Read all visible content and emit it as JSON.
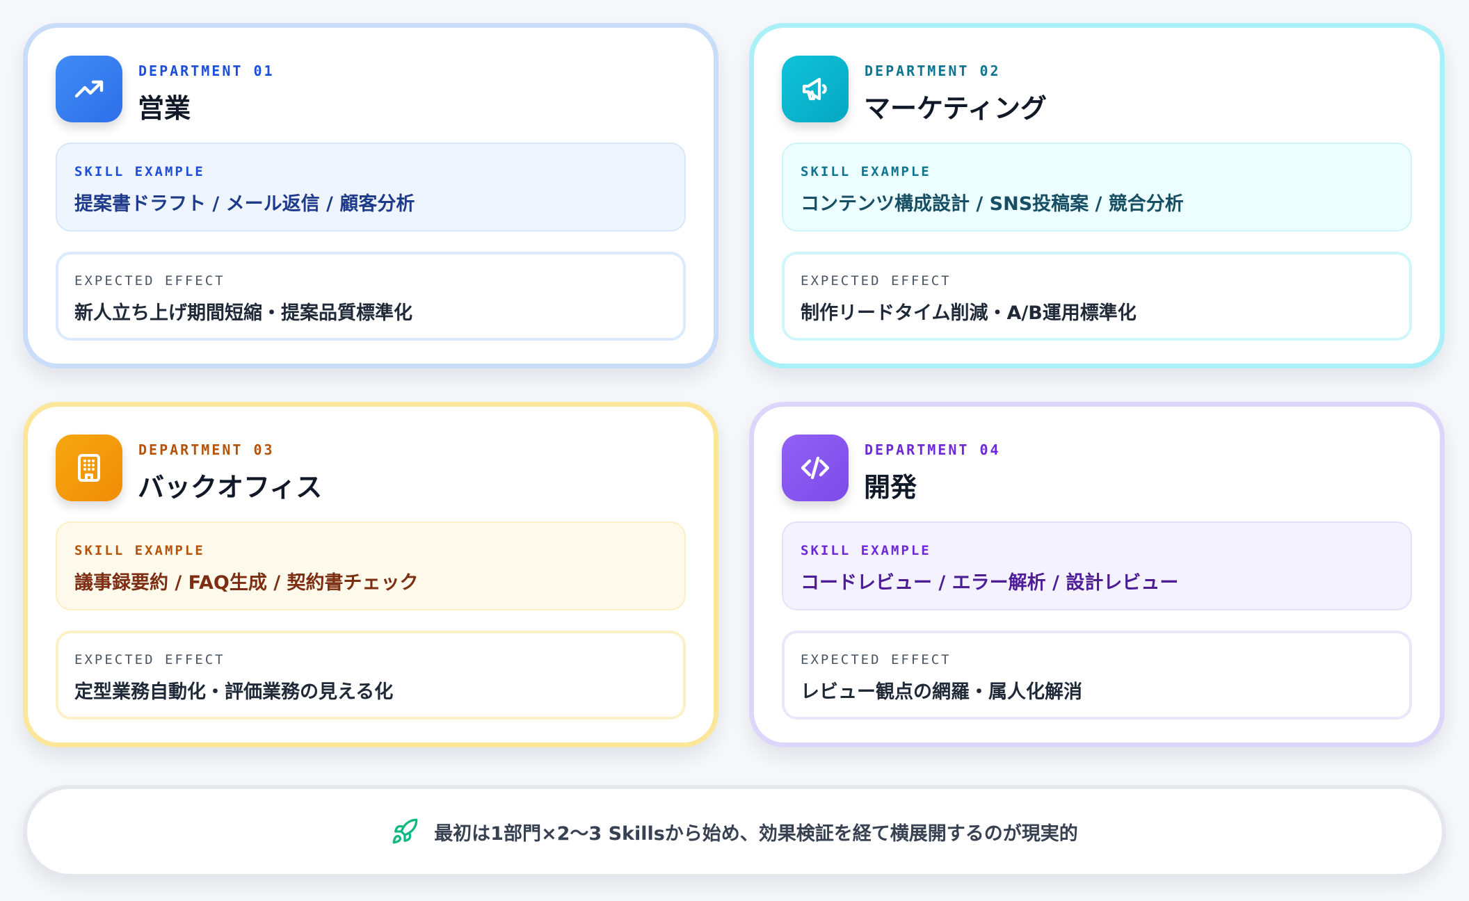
{
  "colors": {
    "sales_accent": "#3b82f6",
    "marketing_accent": "#06b6d4",
    "backoffice_accent": "#f59e0b",
    "dev_accent": "#8b5cf6",
    "footer_icon": "#10b981"
  },
  "departments": [
    {
      "kicker": "DEPARTMENT 01",
      "name": "営業",
      "icon": "trending-up-icon",
      "skill_label": "SKILL EXAMPLE",
      "skill_text": "提案書ドラフト / メール返信 / 顧客分析",
      "effect_label": "EXPECTED EFFECT",
      "effect_text": "新人立ち上げ期間短縮・提案品質標準化"
    },
    {
      "kicker": "DEPARTMENT 02",
      "name": "マーケティング",
      "icon": "megaphone-icon",
      "skill_label": "SKILL EXAMPLE",
      "skill_text": "コンテンツ構成設計 / SNS投稿案 / 競合分析",
      "effect_label": "EXPECTED EFFECT",
      "effect_text": "制作リードタイム削減・A/B運用標準化"
    },
    {
      "kicker": "DEPARTMENT 03",
      "name": "バックオフィス",
      "icon": "building-icon",
      "skill_label": "SKILL EXAMPLE",
      "skill_text": "議事録要約 / FAQ生成 / 契約書チェック",
      "effect_label": "EXPECTED EFFECT",
      "effect_text": "定型業務自動化・評価業務の見える化"
    },
    {
      "kicker": "DEPARTMENT 04",
      "name": "開発",
      "icon": "code-icon",
      "skill_label": "SKILL EXAMPLE",
      "skill_text": "コードレビュー / エラー解析 / 設計レビュー",
      "effect_label": "EXPECTED EFFECT",
      "effect_text": "レビュー観点の網羅・属人化解消"
    }
  ],
  "footer": {
    "icon": "rocket-icon",
    "text": "最初は1部門×2〜3 Skillsから始め、効果検証を経て横展開するのが現実的"
  }
}
